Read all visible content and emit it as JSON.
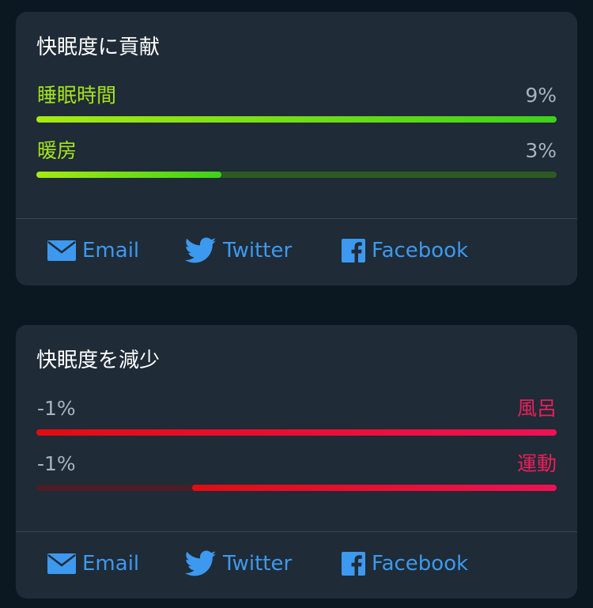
{
  "colors": {
    "page_background": "#0c1821",
    "card_background": "#1f2b36",
    "positive_accent": "#a6e51a",
    "positive_bar": "#3ed11a",
    "negative_accent": "#ea1f5a",
    "negative_bar": "#e00d12",
    "link_blue": "#3d99ef",
    "muted_text": "#aab3bb"
  },
  "cards": [
    {
      "title": "快眠度に貢献",
      "direction": "positive",
      "rows": [
        {
          "label": "睡眠時間",
          "value": "9%",
          "fill_fraction": 1.0
        },
        {
          "label": "暖房",
          "value": "3%",
          "fill_fraction": 0.355
        }
      ],
      "share": {
        "email_label": "Email",
        "twitter_label": "Twitter",
        "facebook_label": "Facebook"
      }
    },
    {
      "title": "快眠度を減少",
      "direction": "negative",
      "rows": [
        {
          "label": "風呂",
          "value": "-1%",
          "fill_fraction": 1.0
        },
        {
          "label": "運動",
          "value": "-1%",
          "fill_fraction": 0.7
        }
      ],
      "share": {
        "email_label": "Email",
        "twitter_label": "Twitter",
        "facebook_label": "Facebook"
      }
    }
  ],
  "icons": {
    "email": "envelope-icon",
    "twitter": "twitter-bird-icon",
    "facebook": "facebook-f-icon"
  }
}
